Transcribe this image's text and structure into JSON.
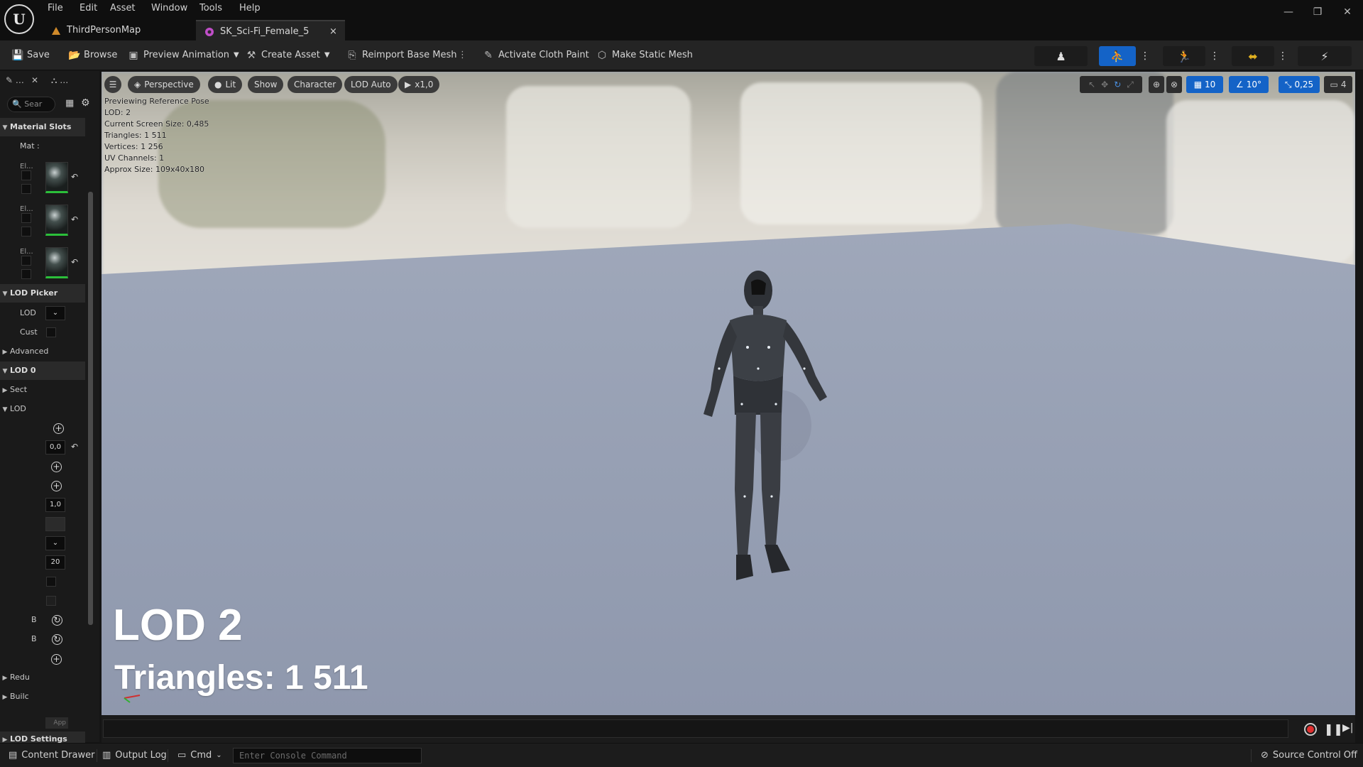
{
  "menu": [
    "File",
    "Edit",
    "Asset",
    "Window",
    "Tools",
    "Help"
  ],
  "tabs": [
    {
      "label": "ThirdPersonMap"
    },
    {
      "label": "SK_Sci-Fi_Female_5",
      "close": "×"
    }
  ],
  "window_controls": {
    "minimize": "—",
    "restore": "❐",
    "close": "✕"
  },
  "toolbar": {
    "save": "Save",
    "browse": "Browse",
    "preview_animation": "Preview Animation",
    "create_asset": "Create Asset",
    "reimport": "Reimport Base Mesh",
    "cloth_paint": "Activate Cloth Paint",
    "make_static": "Make Static Mesh"
  },
  "left_panel": {
    "search_placeholder": "Sear",
    "material_slots": "Material Slots",
    "mat_label": "Mat",
    "element_label": "El...",
    "lod_picker": "LOD Picker",
    "lod_label": "LOD",
    "cust_label": "Cust",
    "advanced": "Advanced",
    "lod0": "LOD 0",
    "sect": "Sect",
    "lod_sub": "LOD",
    "field_1": "0,0",
    "field_2": "1,0",
    "field_3": "20",
    "b_label": "B",
    "redu": "Redu",
    "build": "Builc",
    "apply": "App",
    "lod_settings": "LOD Settings"
  },
  "viewport": {
    "perspective": "Perspective",
    "lit": "Lit",
    "show": "Show",
    "character": "Character",
    "lod_auto": "LOD Auto",
    "play_speed": "x1,0",
    "grid_snap": "10",
    "rot_snap": "10°",
    "scale_snap": "0,25",
    "camera_speed": "4",
    "info_lines": [
      "Previewing Reference Pose",
      "LOD: 2",
      "Current Screen Size: 0,485",
      "Triangles: 1 511",
      "Vertices: 1 256",
      "UV Channels: 1",
      "Approx Size: 109x40x180"
    ],
    "lod_overlay": "LOD 2",
    "triangles_overlay": "Triangles: 1 511"
  },
  "statusbar": {
    "content_drawer": "Content Drawer",
    "output_log": "Output Log",
    "cmd": "Cmd",
    "console_placeholder": "Enter Console Command",
    "source_control": "Source Control Off"
  },
  "colors": {
    "accent_blue": "#1463c7",
    "green_indicator": "#2bbf3a",
    "record_red": "#e03030"
  }
}
